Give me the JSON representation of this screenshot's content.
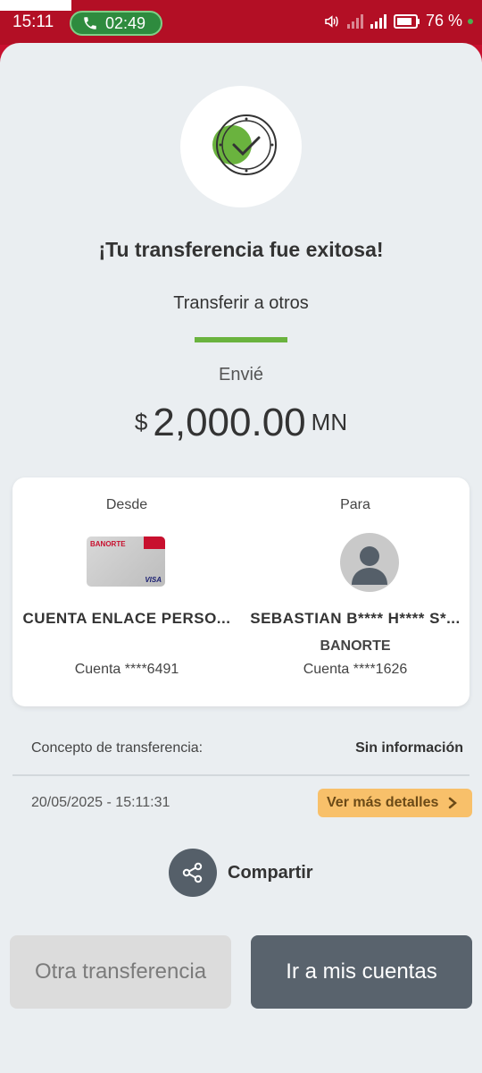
{
  "status_bar": {
    "time": "15:11",
    "call_timer": "02:49",
    "battery": "76 %"
  },
  "screen": {
    "title": "¡Tu transferencia fue exitosa!",
    "subtitle": "Transferir a otros",
    "sent_label": "Envié",
    "amount": {
      "currency_symbol": "$",
      "value": "2,000.00",
      "currency_code": "MN"
    }
  },
  "card": {
    "from": {
      "label": "Desde",
      "name": "CUENTA ENLACE PERSO...",
      "account": "Cuenta ****6491",
      "card_brand": "BANORTE",
      "card_network": "VISA"
    },
    "to": {
      "label": "Para",
      "name": "SEBASTIAN B**** H**** S*...",
      "bank": "BANORTE",
      "account": "Cuenta ****1626"
    }
  },
  "details": {
    "concept_label": "Concepto de transferencia:",
    "concept_value": "Sin información",
    "datetime": "20/05/2025 - 15:11:31",
    "more_details_label": "Ver más detalles"
  },
  "share": {
    "label": "Compartir"
  },
  "buttons": {
    "other_transfer": "Otra transferencia",
    "go_to_accounts": "Ir a mis cuentas"
  },
  "colors": {
    "brand_red": "#c8102e",
    "success_green": "#6ab33e",
    "details_button": "#f8c06a",
    "primary_button": "#59636d"
  }
}
